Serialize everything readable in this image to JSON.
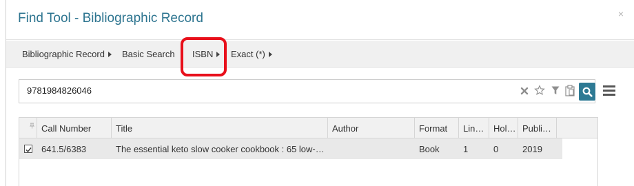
{
  "dialog": {
    "title": "Find Tool - Bibliographic Record",
    "close_icon": "×"
  },
  "breadcrumbs": [
    {
      "label": "Bibliographic Record"
    },
    {
      "label": "Basic Search"
    },
    {
      "label": "ISBN"
    },
    {
      "label": "Exact (*)"
    }
  ],
  "search": {
    "value": "9781984826046"
  },
  "toolbar_icons": [
    "clear-icon",
    "star-icon",
    "filter-icon",
    "clipboard-icon",
    "search-icon",
    "menu-icon"
  ],
  "grid": {
    "columns": [
      "Call Number",
      "Title",
      "Author",
      "Format",
      "Lin…",
      "Hol…",
      "Publi…"
    ],
    "rows": [
      {
        "selected": true,
        "call_number": "641.5/6383",
        "title": "The essential keto slow cooker cookbook : 65 low-…",
        "author": "",
        "format": "Book",
        "lin": "1",
        "hol": "0",
        "publi": "2019"
      }
    ]
  },
  "colors": {
    "title": "#2e7590",
    "search_button": "#2e7a94",
    "highlight": "#e8101b",
    "row_selected": "#e9e9e9"
  }
}
